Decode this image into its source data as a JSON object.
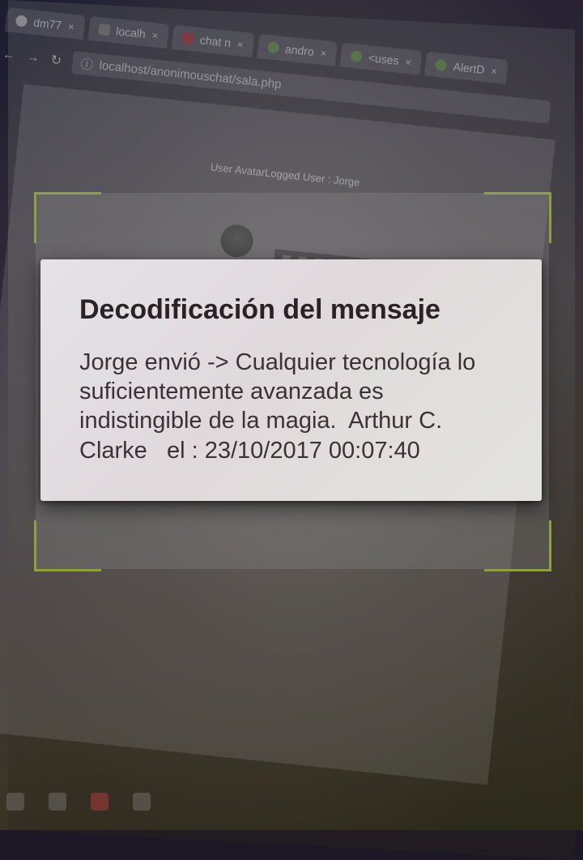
{
  "browser": {
    "tabs": [
      {
        "label": "dm77",
        "icon": "github-icon"
      },
      {
        "label": "localh",
        "icon": "page-icon"
      },
      {
        "label": "chat n",
        "icon": "xampp-icon"
      },
      {
        "label": "andro",
        "icon": "android-icon"
      },
      {
        "label": "<uses",
        "icon": "android-icon"
      },
      {
        "label": "AlertD",
        "icon": "android-icon"
      }
    ],
    "url": "localhost/anonimouschat/sala.php"
  },
  "page": {
    "user_line": "User AvatarLogged User : Jorge"
  },
  "dialog": {
    "title": "Decodificación del mensaje",
    "message": "Jorge envió -> Cualquier tecnología lo suficientemente avanzada es indistingible de la magia.  Arthur C. Clarke   el : 23/10/2017 00:07:40"
  },
  "colors": {
    "scanner_corner": "#8ea040",
    "dialog_bg": "#e2dfe3",
    "dialog_title": "#2b2226"
  }
}
